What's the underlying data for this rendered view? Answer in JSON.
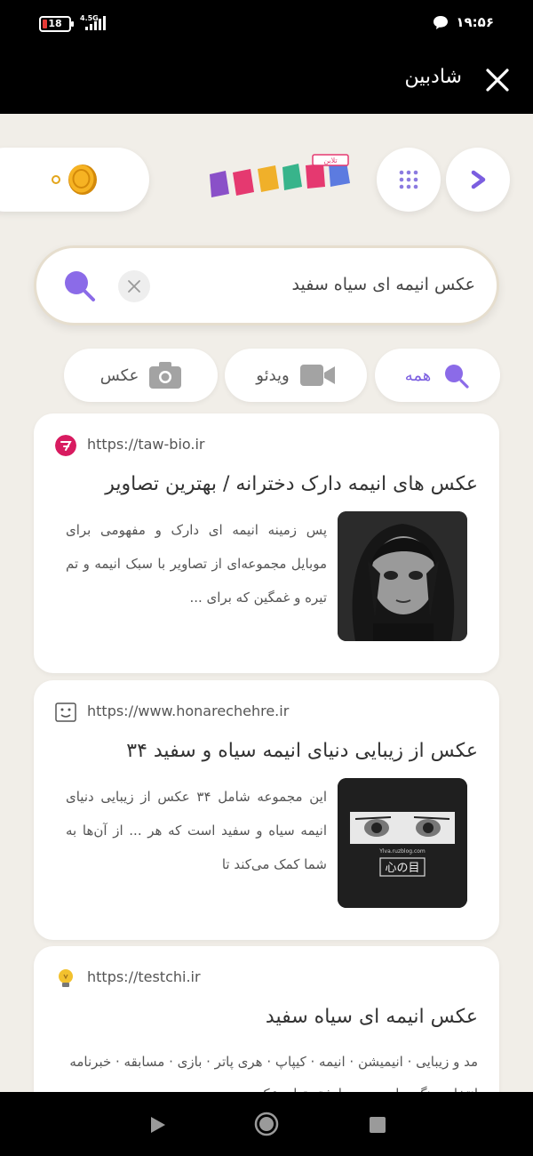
{
  "status_bar": {
    "battery_level": "18",
    "network": "4.5G",
    "time": "۱۹:۵۶"
  },
  "header": {
    "title": "شادبین",
    "close_icon": "close-icon"
  },
  "topbar": {
    "coin_icon": "coin-icon",
    "logo_text": "شادبین",
    "logo_badge": "تلاین",
    "apps_icon": "grid-icon",
    "forward_icon": "chevron-right-icon"
  },
  "search": {
    "query": "عکس انیمه ای سیاه سفید",
    "clear_icon": "x-icon",
    "search_icon": "search-icon"
  },
  "filters": [
    {
      "label": "همه",
      "icon": "search-icon",
      "active": true
    },
    {
      "label": "ویدئو",
      "icon": "video-icon",
      "active": false
    },
    {
      "label": "عکس",
      "icon": "camera-icon",
      "active": false
    }
  ],
  "results": [
    {
      "url": "https://taw-bio.ir",
      "title": "عکس های انیمه دارک دخترانه / بهترین تصاویر",
      "description": "پس زمینه انیمه ای دارک و مفهومی برای موبایل مجموعه‌ای از تصاویر با سبک انیمه و تم تیره و غمگین که برای ...",
      "favicon_color": "#d81b60"
    },
    {
      "url": "https://www.honarechehre.ir",
      "title": "عکس از زیبایی دنیای انیمه سیاه و سفید ۳۴",
      "description": "این مجموعه شامل ۳۴ عکس از زیبایی دنیای انیمه سیاه و سفید است که هر ... از آن‌ها به شما کمک می‌کند تا",
      "thumb_caption": "心の目",
      "thumb_watermark": "Ylva.ruzblog.com"
    },
    {
      "url": "https://testchi.ir",
      "title": "عکس انیمه ای سیاه سفید",
      "description": "مد و زیبایی · انیمیشن · انیمه · کیپاپ · هری پاتر · بازی · مسابقه · خبرنامه انتخاب رنگ سایت چرچ با شتر تهای عکس"
    }
  ],
  "nav": {
    "back_icon": "triangle-back-icon",
    "home_icon": "circle-home-icon",
    "recent_icon": "square-recent-icon"
  },
  "colors": {
    "accent": "#7b5ee0",
    "background": "#f1eee8",
    "coin": "#e3a51b"
  }
}
